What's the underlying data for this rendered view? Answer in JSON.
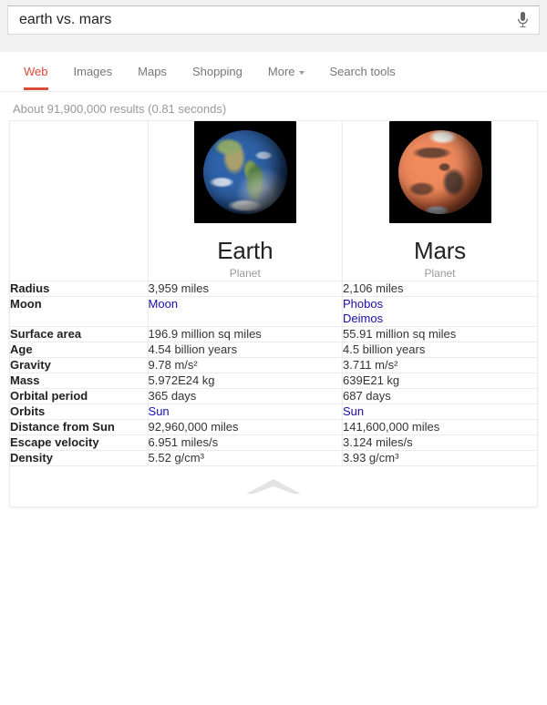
{
  "search": {
    "query": "earth vs. mars",
    "placeholder": "Search",
    "mic_icon": "microphone-icon"
  },
  "nav": {
    "items": [
      {
        "label": "Web",
        "active": true
      },
      {
        "label": "Images",
        "active": false
      },
      {
        "label": "Maps",
        "active": false
      },
      {
        "label": "Shopping",
        "active": false
      },
      {
        "label": "More",
        "active": false,
        "has_caret": true
      },
      {
        "label": "Search tools",
        "active": false
      }
    ],
    "active_color": "#dd4b39"
  },
  "result_stats": "About 91,900,000 results (0.81 seconds)",
  "knowledge_card": {
    "entities": [
      {
        "name": "Earth",
        "type": "Planet",
        "image": "earth-globe-image"
      },
      {
        "name": "Mars",
        "type": "Planet",
        "image": "mars-globe-image"
      }
    ],
    "rows": [
      {
        "label": "Radius",
        "earth": {
          "text": "3,959 miles",
          "link": false
        },
        "mars": {
          "text": "2,106 miles",
          "link": false
        }
      },
      {
        "label": "Moon",
        "earth": {
          "links": [
            "Moon"
          ],
          "link": true
        },
        "mars": {
          "links": [
            "Phobos",
            "Deimos"
          ],
          "link": true
        }
      },
      {
        "label": "Surface area",
        "earth": {
          "text": "196.9 million sq miles",
          "link": false
        },
        "mars": {
          "text": "55.91 million sq miles",
          "link": false
        }
      },
      {
        "label": "Age",
        "earth": {
          "text": "4.54 billion years",
          "link": false
        },
        "mars": {
          "text": "4.5 billion years",
          "link": false
        }
      },
      {
        "label": "Gravity",
        "earth": {
          "text": "9.78 m/s²",
          "link": false
        },
        "mars": {
          "text": "3.711 m/s²",
          "link": false
        }
      },
      {
        "label": "Mass",
        "earth": {
          "text": "5.972E24 kg",
          "link": false
        },
        "mars": {
          "text": "639E21 kg",
          "link": false
        }
      },
      {
        "label": "Orbital period",
        "earth": {
          "text": "365 days",
          "link": false
        },
        "mars": {
          "text": "687 days",
          "link": false
        }
      },
      {
        "label": "Orbits",
        "earth": {
          "links": [
            "Sun"
          ],
          "link": true
        },
        "mars": {
          "links": [
            "Sun"
          ],
          "link": true
        }
      },
      {
        "label": "Distance from Sun",
        "earth": {
          "text": "92,960,000 miles",
          "link": false
        },
        "mars": {
          "text": "141,600,000 miles",
          "link": false
        }
      },
      {
        "label": "Escape velocity",
        "earth": {
          "text": "6.951 miles/s",
          "link": false
        },
        "mars": {
          "text": "3.124 miles/s",
          "link": false
        }
      },
      {
        "label": "Density",
        "earth": {
          "text": "5.52 g/cm³",
          "link": false
        },
        "mars": {
          "text": "3.93 g/cm³",
          "link": false
        }
      }
    ],
    "footer_icon": "chevron-up-icon",
    "link_color": "#1a0dab"
  }
}
